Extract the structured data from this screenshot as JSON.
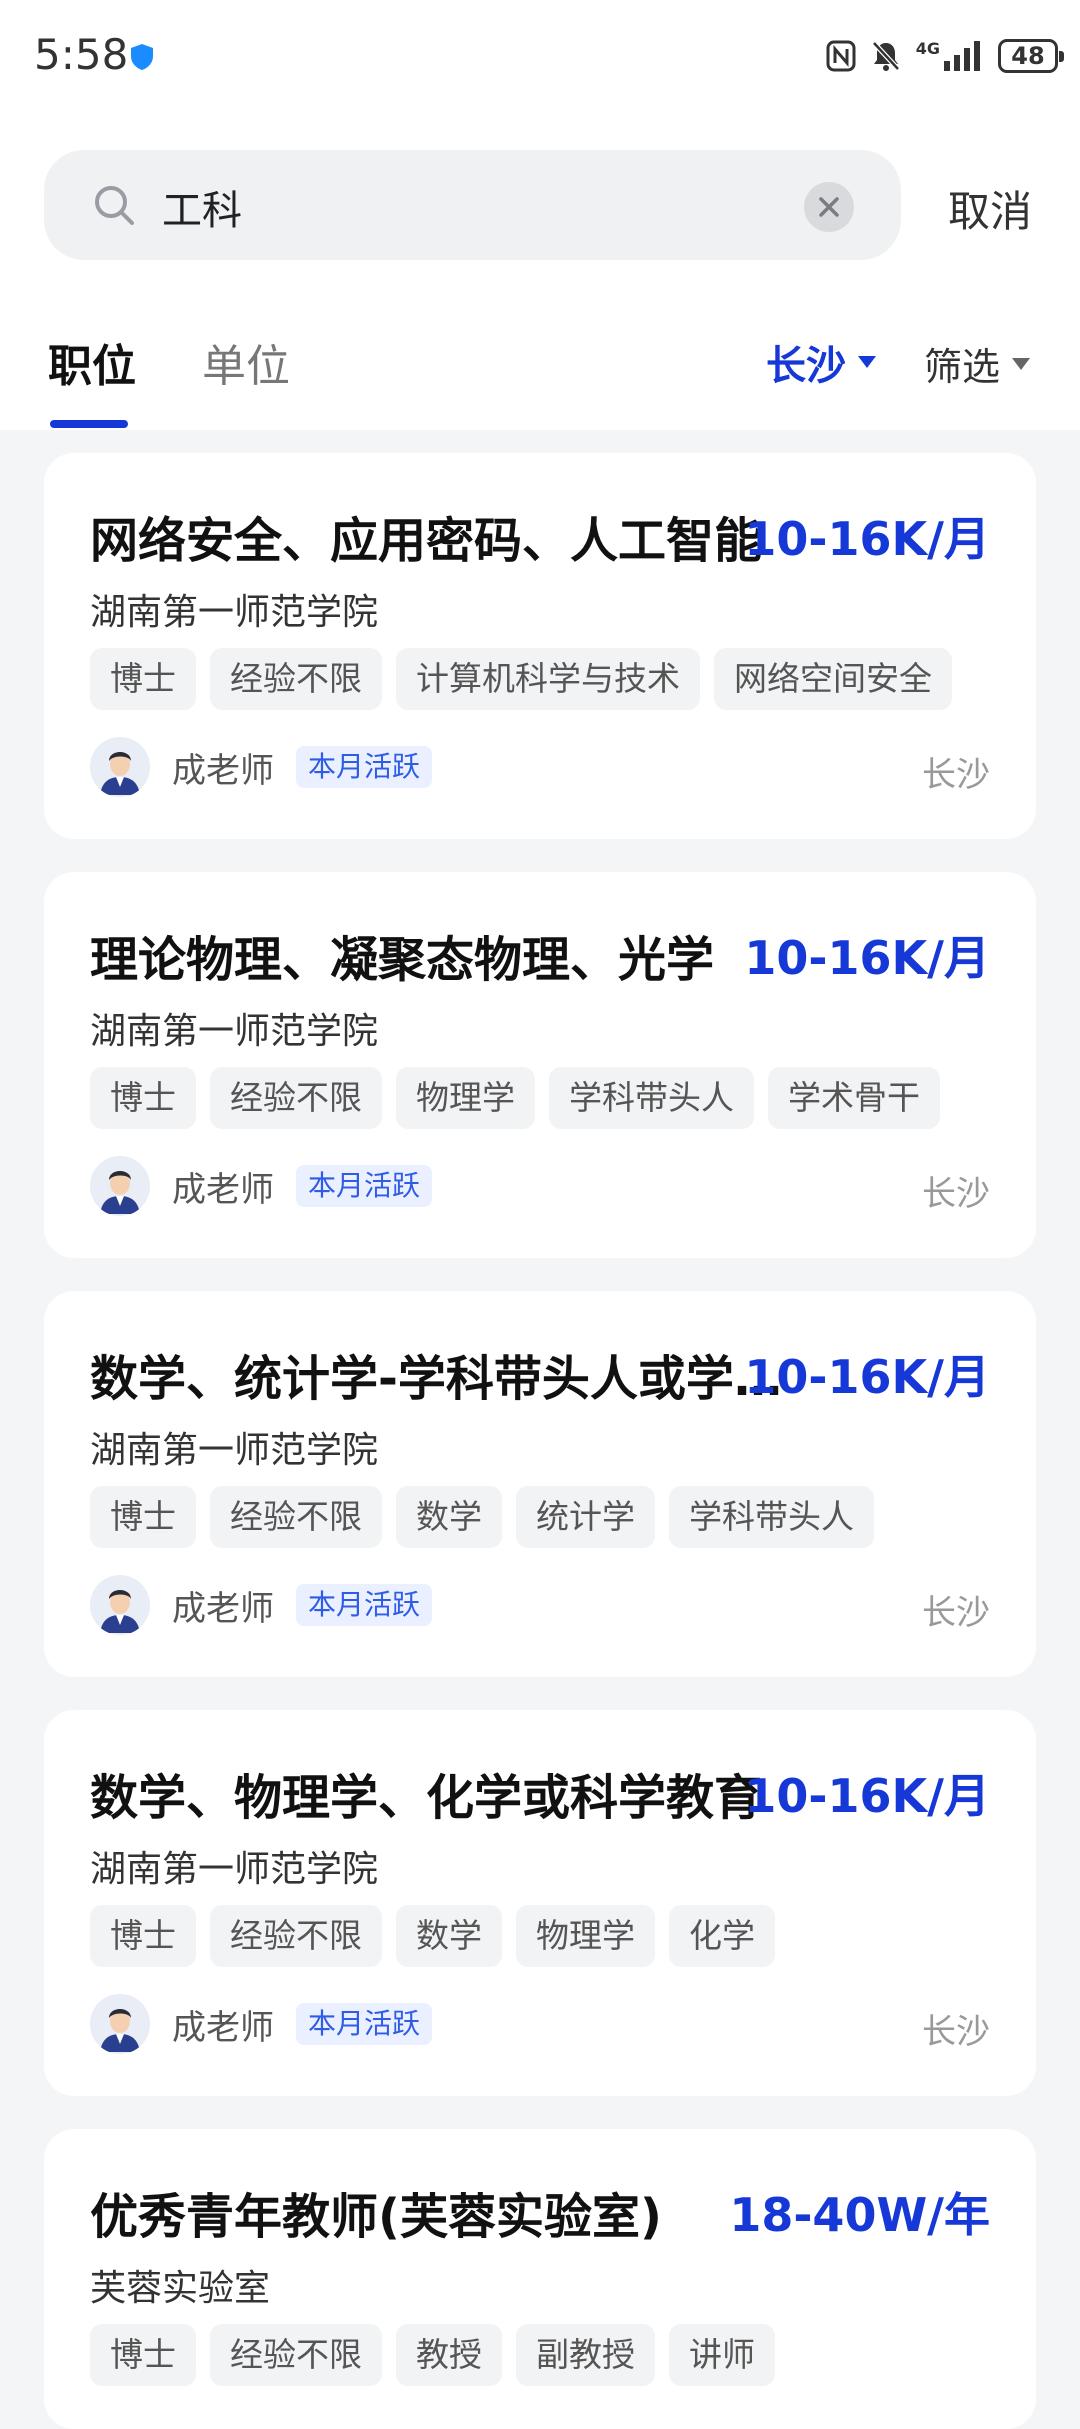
{
  "status_bar": {
    "time": "5:58",
    "network": "4G",
    "battery": "48"
  },
  "search": {
    "query": "工科",
    "cancel_label": "取消"
  },
  "tabs": [
    {
      "label": "职位",
      "active": true
    },
    {
      "label": "单位",
      "active": false
    }
  ],
  "filters": {
    "city": "长沙",
    "screen": "筛选"
  },
  "colors": {
    "accent": "#1538d6",
    "badge_bg": "#eaf0ff",
    "tag_bg": "#f2f3f5"
  },
  "jobs": [
    {
      "title": "网络安全、应用密码、人工智能",
      "salary": "10-16K/月",
      "org": "湖南第一师范学院",
      "tags": [
        "博士",
        "经验不限",
        "计算机科学与技术",
        "网络空间安全"
      ],
      "recruiter": "成老师",
      "badge": "本月活跃",
      "city": "长沙"
    },
    {
      "title": "理论物理、凝聚态物理、光学",
      "salary": "10-16K/月",
      "org": "湖南第一师范学院",
      "tags": [
        "博士",
        "经验不限",
        "物理学",
        "学科带头人",
        "学术骨干"
      ],
      "recruiter": "成老师",
      "badge": "本月活跃",
      "city": "长沙"
    },
    {
      "title": "数学、统计学-学科带头人或学术骨干",
      "salary": "10-16K/月",
      "org": "湖南第一师范学院",
      "tags": [
        "博士",
        "经验不限",
        "数学",
        "统计学",
        "学科带头人"
      ],
      "recruiter": "成老师",
      "badge": "本月活跃",
      "city": "长沙"
    },
    {
      "title": "数学、物理学、化学或科学教育",
      "salary": "10-16K/月",
      "org": "湖南第一师范学院",
      "tags": [
        "博士",
        "经验不限",
        "数学",
        "物理学",
        "化学"
      ],
      "recruiter": "成老师",
      "badge": "本月活跃",
      "city": "长沙"
    },
    {
      "title": "优秀青年教师(芙蓉实验室)",
      "salary": "18-40W/年",
      "org": "芙蓉实验室",
      "tags": [
        "博士",
        "经验不限",
        "教授",
        "副教授",
        "讲师"
      ]
    }
  ]
}
